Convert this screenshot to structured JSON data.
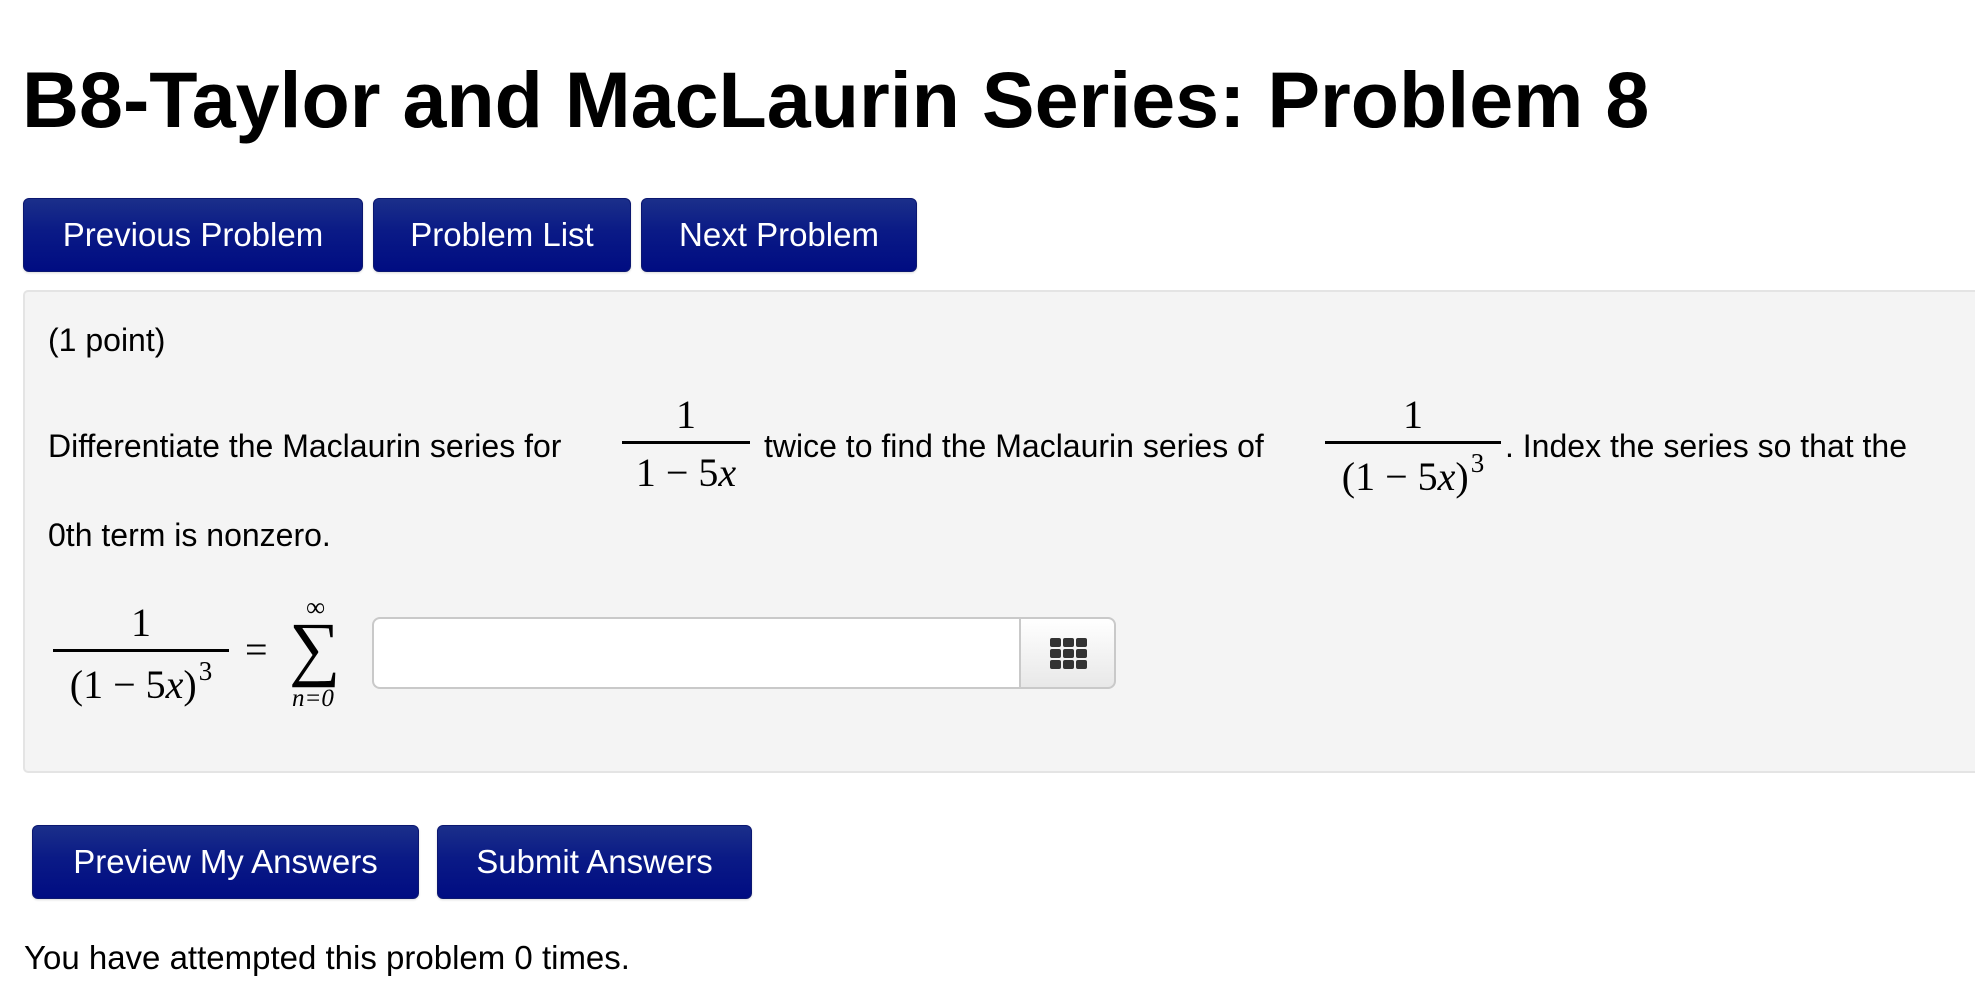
{
  "page": {
    "title": "B8-Taylor and MacLaurin Series: Problem 8"
  },
  "nav": {
    "previous_label": "Previous Problem",
    "list_label": "Problem List",
    "next_label": "Next Problem"
  },
  "problem": {
    "points": "(1 point)",
    "text_part1": "Differentiate the Maclaurin series for",
    "text_part2": "twice to find the Maclaurin series of",
    "text_part3": ". Index the series so that the",
    "text_part4": "0th term is nonzero.",
    "frac1": {
      "numerator": "1",
      "denominator_text": "1 − 5",
      "denominator_var": "x"
    },
    "frac2": {
      "numerator": "1",
      "denominator_text": "(1 − 5",
      "denominator_var": "x",
      "denominator_close": ")",
      "exponent": "3"
    },
    "answer_equation": {
      "lhs_numerator": "1",
      "lhs_denominator_text": "(1 − 5",
      "lhs_denominator_var": "x",
      "lhs_denominator_close": ")",
      "lhs_exponent": "3",
      "equals": "=",
      "sum_symbol": "∑",
      "sum_upper": "∞",
      "sum_lower": "n=0"
    },
    "answer_value": "",
    "answer_placeholder": "",
    "keypad_icon": "keypad-grid-icon"
  },
  "actions": {
    "preview_label": "Preview My Answers",
    "submit_label": "Submit Answers"
  },
  "status": {
    "attempts_text": "You have attempted this problem 0 times."
  },
  "colors": {
    "button_top": "#1b2f8a",
    "button_bottom": "#000c82",
    "panel_bg": "#f4f4f4"
  }
}
